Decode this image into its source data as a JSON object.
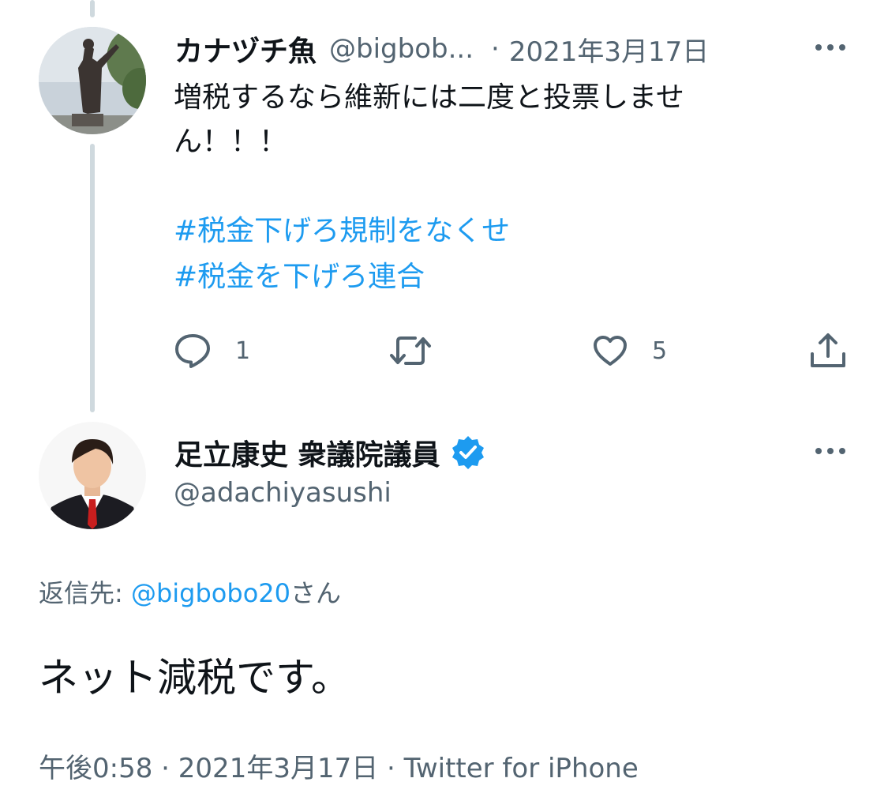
{
  "reply_tweet": {
    "display_name": "カナヅチ魚",
    "handle": "@bigbob...",
    "separator": "·",
    "date": "2021年3月17日",
    "text": "増税するなら維新には二度と投票しません！！！",
    "hashtags": [
      "#税金下げろ規制をなくせ",
      "#税金を下げろ連合"
    ],
    "reply_count": "1",
    "like_count": "5"
  },
  "main_tweet": {
    "display_name": "足立康史 衆議院議員",
    "handle": "@adachiyasushi",
    "reply_to_label": "返信先: ",
    "reply_to_mention": "@bigbobo20",
    "reply_to_suffix": "さん",
    "text": "ネット減税です。",
    "time": "午後0:58",
    "separator": " · ",
    "date": "2021年3月17日",
    "source": "Twitter for iPhone"
  },
  "colors": {
    "accent": "#1d9bf0",
    "secondary_text": "#536471",
    "thread_line": "#cfd9de",
    "verified_badge": "#1d9bf0"
  },
  "icons": {
    "reply": "speech-bubble-icon",
    "retweet": "retweet-arrows-icon",
    "like": "heart-icon",
    "share": "share-upload-icon",
    "more": "ellipsis-icon",
    "verified": "verified-badge-icon"
  }
}
